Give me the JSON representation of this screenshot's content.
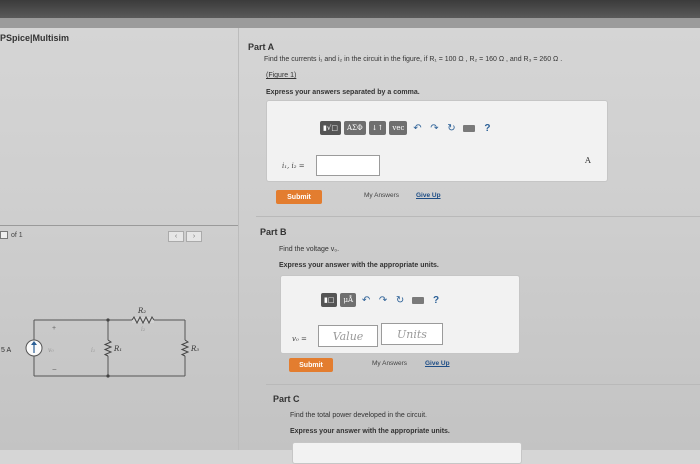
{
  "app": {
    "title": "PSpice|Multisim"
  },
  "figure": {
    "pager_text": "of 1",
    "labels": {
      "source": "5 A",
      "vo": "v₀",
      "r1": "R₁",
      "r2": "R₂",
      "r3": "R₃",
      "i1": "i₁",
      "i2": "i₂"
    }
  },
  "partA": {
    "title": "Part A",
    "question": "Find the currents i₁ and i₂ in the circuit in the figure, if R₁ = 100 Ω , R₂ = 160 Ω , and R₃ = 260 Ω .",
    "figure_link": "(Figure 1)",
    "instruction": "Express your answers separated by a comma.",
    "toolbar": {
      "templates": "▮√□",
      "greek": "ΑΣΦ",
      "sort": "↓↑",
      "vec": "vec",
      "undo": "↶",
      "redo": "↷",
      "reset": "↻",
      "help": "?"
    },
    "var_label": "i₁, i₂ =",
    "unit": "A",
    "submit": "Submit",
    "my_answers": "My Answers",
    "give_up": "Give Up"
  },
  "partB": {
    "title": "Part B",
    "question": "Find the voltage v₀.",
    "instruction": "Express your answer with the appropriate units.",
    "toolbar": {
      "templates": "▮□",
      "units": "μÅ",
      "undo": "↶",
      "redo": "↷",
      "reset": "↻",
      "help": "?"
    },
    "var_label": "v₀ =",
    "value_placeholder": "Value",
    "units_placeholder": "Units",
    "submit": "Submit",
    "my_answers": "My Answers",
    "give_up": "Give Up"
  },
  "partC": {
    "title": "Part C",
    "question": "Find the total power developed in the circuit.",
    "instruction": "Express your answer with the appropriate units."
  }
}
